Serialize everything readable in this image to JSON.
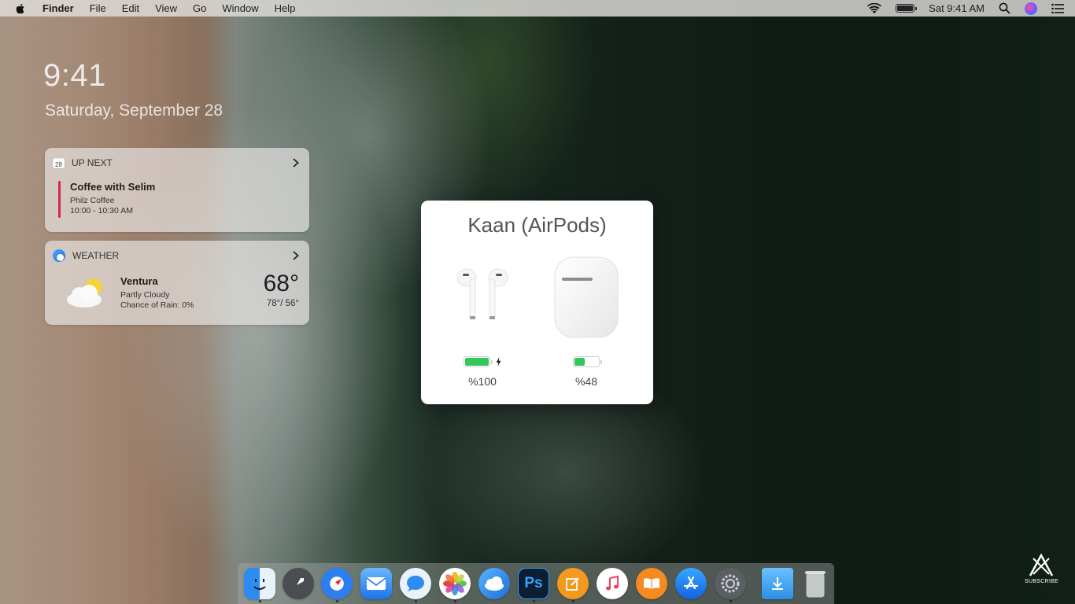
{
  "menubar": {
    "app_name": "Finder",
    "menus": [
      "File",
      "Edit",
      "View",
      "Go",
      "Window",
      "Help"
    ],
    "status": {
      "datetime": "Sat 9:41 AM"
    },
    "icons": [
      "apple-icon",
      "wifi-icon",
      "battery-icon",
      "search-icon",
      "siri-icon",
      "notification-center-icon"
    ]
  },
  "lockscreen": {
    "time": "9:41",
    "date": "Saturday, September 28"
  },
  "widgets": {
    "upnext": {
      "header": "UP NEXT",
      "calendar_day": "28",
      "event_title": "Coffee with Selim",
      "event_location": "Philz Coffee",
      "event_time": "10:00 - 10:30 AM",
      "accent": "#d0245a"
    },
    "weather": {
      "header": "WEATHER",
      "city": "Ventura",
      "condition": "Partly Cloudy",
      "rain": "Chance of Rain: 0%",
      "temperature": "68°",
      "hilo": "78°/ 56°"
    }
  },
  "airpods_popup": {
    "title": "Kaan (AirPods)",
    "devices": [
      {
        "name": "earbuds",
        "battery_percent": 100,
        "label": "%100",
        "charging": true
      },
      {
        "name": "case",
        "battery_percent": 48,
        "label": "%48",
        "charging": false
      }
    ],
    "battery_color": "#34c759"
  },
  "dock": {
    "apps": [
      "Finder",
      "Launchpad",
      "Safari",
      "Mail",
      "Messages",
      "Photos",
      "Weather",
      "Photoshop",
      "Pages",
      "iTunes",
      "Books",
      "App Store",
      "System Preferences",
      "Downloads",
      "Trash"
    ]
  },
  "watermark": {
    "label": "SUBSCRIBE"
  }
}
